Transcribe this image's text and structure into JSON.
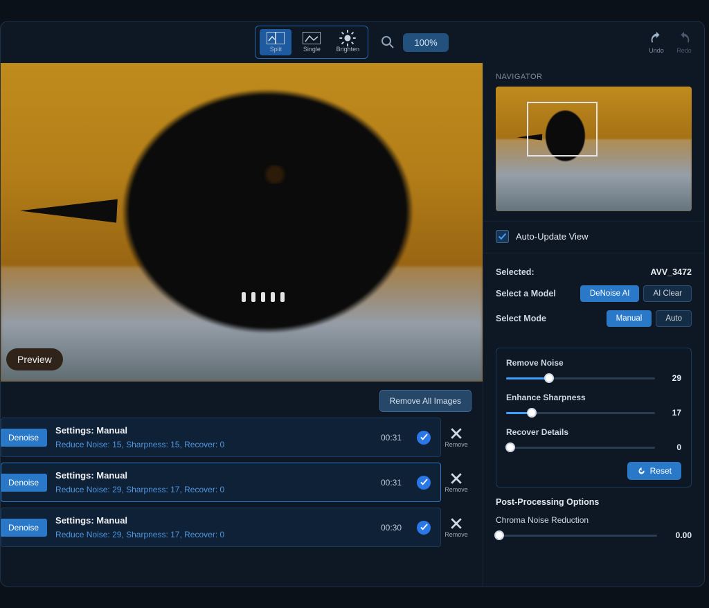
{
  "toolbar": {
    "views": {
      "split": "Split",
      "single": "Single",
      "brighten": "Brighten"
    },
    "zoom": "100%",
    "undo": "Undo",
    "redo": "Redo"
  },
  "preview": {
    "label": "Preview"
  },
  "removeAll": "Remove All Images",
  "queue": [
    {
      "tag": "Denoise",
      "title": "Settings: Manual",
      "sub": "Reduce Noise: 15, Sharpness: 15, Recover: 0",
      "time": "00:31",
      "remove": "Remove",
      "active": false
    },
    {
      "tag": "Denoise",
      "title": "Settings: Manual",
      "sub": "Reduce Noise: 29, Sharpness: 17, Recover: 0",
      "time": "00:31",
      "remove": "Remove",
      "active": true
    },
    {
      "tag": "Denoise",
      "title": "Settings: Manual",
      "sub": "Reduce Noise: 29, Sharpness: 17, Recover: 0",
      "time": "00:30",
      "remove": "Remove",
      "active": false
    }
  ],
  "right": {
    "navigator": "NAVIGATOR",
    "autoUpdate": "Auto-Update View",
    "selectedLabel": "Selected:",
    "selectedValue": "AVV_3472",
    "selectModel": "Select a Model",
    "modelA": "DeNoise AI",
    "modelB": "AI Clear",
    "selectMode": "Select Mode",
    "modeA": "Manual",
    "modeB": "Auto",
    "sliders": {
      "noise": {
        "label": "Remove Noise",
        "value": 29
      },
      "sharp": {
        "label": "Enhance Sharpness",
        "value": 17
      },
      "recover": {
        "label": "Recover Details",
        "value": 0
      }
    },
    "reset": "Reset",
    "postTitle": "Post-Processing Options",
    "chroma": {
      "label": "Chroma Noise Reduction",
      "value": "0.00"
    }
  }
}
